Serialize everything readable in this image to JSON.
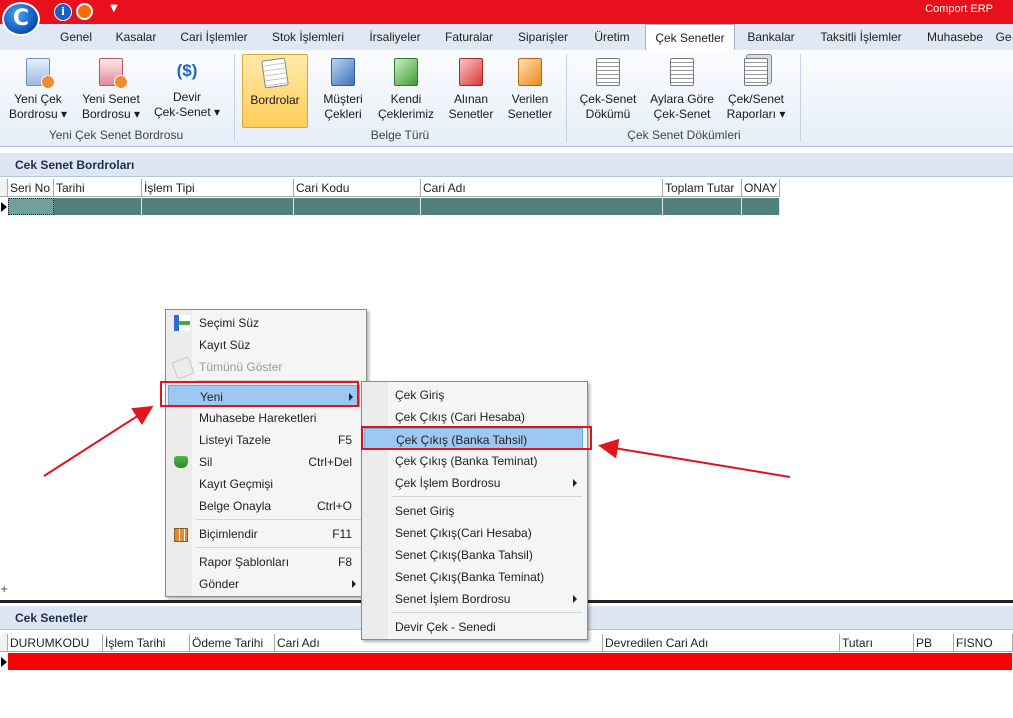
{
  "app": {
    "title": "Comport ERP",
    "logo_letter": "C"
  },
  "colors": {
    "titlebar": "#e8101c",
    "accent_red": "#e0141b",
    "row_teal": "#4f807c",
    "row_red": "#ff0000",
    "highlight": "#9dc8f3"
  },
  "tabs": [
    {
      "label": "Genel"
    },
    {
      "label": "Kasalar"
    },
    {
      "label": "Cari İşlemler"
    },
    {
      "label": "Stok İşlemleri"
    },
    {
      "label": "İrsaliyeler"
    },
    {
      "label": "Faturalar"
    },
    {
      "label": "Siparişler"
    },
    {
      "label": "Üretim"
    },
    {
      "label": "Çek Senetler",
      "active": true
    },
    {
      "label": "Bankalar"
    },
    {
      "label": "Taksitli İşlemler"
    },
    {
      "label": "Muhasebe"
    },
    {
      "label": "Ge"
    }
  ],
  "ribbon": {
    "groups": [
      {
        "label": "Yeni Çek Senet Bordrosu"
      },
      {
        "label": "Belge Türü"
      },
      {
        "label": "Çek Senet Dökümleri"
      }
    ],
    "buttons": [
      {
        "line1": "Yeni Çek",
        "line2": "Bordrosu ▾",
        "icon": "new-check-icon"
      },
      {
        "line1": "Yeni Senet",
        "line2": "Bordrosu ▾",
        "icon": "new-note-icon"
      },
      {
        "line1": "Devir",
        "line2": "Çek-Senet ▾",
        "icon": "transfer-dollar-icon"
      },
      {
        "line1": "Bordrolar",
        "line2": "",
        "icon": "notepad-icon"
      },
      {
        "line1": "Müşteri",
        "line2": "Çekleri",
        "icon": "customer-checks-icon"
      },
      {
        "line1": "Kendi",
        "line2": "Çeklerimiz",
        "icon": "own-checks-icon"
      },
      {
        "line1": "Alınan",
        "line2": "Senetler",
        "icon": "received-notes-icon"
      },
      {
        "line1": "Verilen",
        "line2": "Senetler",
        "icon": "given-notes-icon"
      },
      {
        "line1": "Çek-Senet",
        "line2": "Dökümü",
        "icon": "report-icon"
      },
      {
        "line1": "Aylara Göre",
        "line2": "Çek-Senet",
        "icon": "monthly-report-icon"
      },
      {
        "line1": "Çek/Senet",
        "line2": "Raporları ▾",
        "icon": "reports-icon"
      }
    ]
  },
  "top_panel": {
    "title": "Cek Senet Bordroları",
    "columns": [
      "Seri No",
      "Tarihi",
      "İşlem Tipi",
      "Cari Kodu",
      "Cari Adı",
      "Toplam Tutar",
      "ONAY"
    ]
  },
  "bottom_panel": {
    "title": "Cek Senetler",
    "columns": [
      "DURUMKODU",
      "İşlem Tarihi",
      "Ödeme Tarihi",
      "Cari Adı",
      "Devredilen Cari Adı",
      "Tutarı",
      "PB",
      "FISNO"
    ]
  },
  "context_menu": {
    "items": [
      {
        "label": "Seçimi Süz",
        "shortcut": "",
        "icon": "filter-selection-icon"
      },
      {
        "label": "Kayıt Süz",
        "shortcut": ""
      },
      {
        "label": "Tümünü Göster",
        "shortcut": "",
        "disabled": true
      },
      {
        "label": "Yeni",
        "shortcut": "",
        "submenu": true,
        "highlighted": true
      },
      {
        "label": "Muhasebe Hareketleri",
        "shortcut": ""
      },
      {
        "label": "Listeyi Tazele",
        "shortcut": "F5"
      },
      {
        "label": "Sil",
        "shortcut": "Ctrl+Del",
        "icon": "delete-icon"
      },
      {
        "label": "Kayıt Geçmişi",
        "shortcut": ""
      },
      {
        "label": "Belge Onayla",
        "shortcut": "Ctrl+O"
      },
      {
        "label": "Biçimlendir",
        "shortcut": "F11",
        "icon": "format-icon"
      },
      {
        "label": "Rapor Şablonları",
        "shortcut": "F8"
      },
      {
        "label": "Gönder",
        "shortcut": "",
        "submenu": true
      }
    ]
  },
  "submenu": {
    "items": [
      {
        "label": "Çek Giriş"
      },
      {
        "label": "Çek Çıkış (Cari Hesaba)"
      },
      {
        "label": "Çek Çıkış (Banka Tahsil)",
        "highlighted": true
      },
      {
        "label": "Çek Çıkış (Banka Teminat)"
      },
      {
        "label": "Çek İşlem Bordrosu",
        "submenu": true
      },
      {
        "label": "Senet Giriş"
      },
      {
        "label": "Senet Çıkış(Cari Hesaba)"
      },
      {
        "label": "Senet Çıkış(Banka Tahsil)"
      },
      {
        "label": "Senet Çıkış(Banka Teminat)"
      },
      {
        "label": "Senet İşlem Bordrosu",
        "submenu": true
      },
      {
        "label": "Devir Çek - Senedi"
      }
    ]
  }
}
